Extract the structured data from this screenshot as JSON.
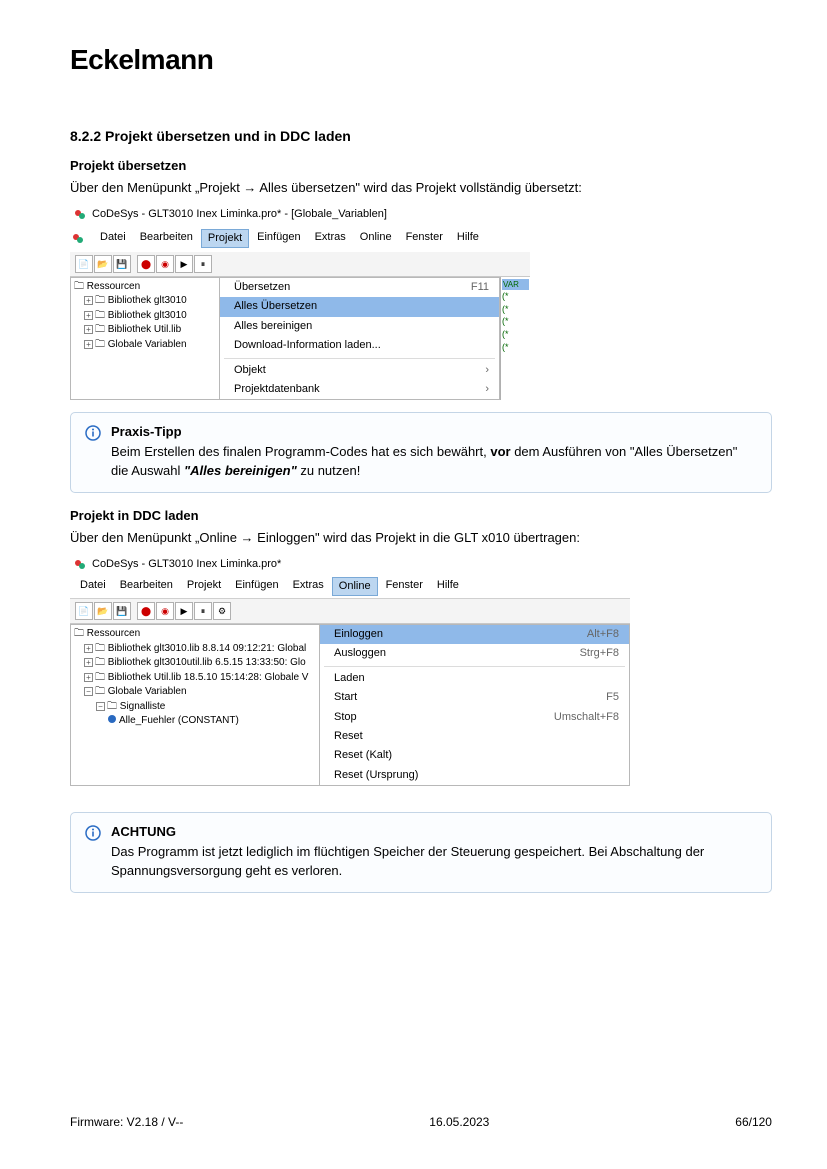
{
  "brand": "Eckelmann",
  "section_number": "8.2.2",
  "section_title": "Projekt übersetzen und in DDC laden",
  "part1": {
    "heading": "Projekt übersetzen",
    "intro": "Über den Menüpunkt „Projekt → Alles übersetzen\" wird das Projekt vollständig übersetzt:",
    "window_title": "CoDeSys - GLT3010 Inex Liminka.pro* - [Globale_Variablen]",
    "menubar": [
      "Datei",
      "Bearbeiten",
      "Projekt",
      "Einfügen",
      "Extras",
      "Online",
      "Fenster",
      "Hilfe"
    ],
    "menu_selected_index": 2,
    "tree_root": "Ressourcen",
    "tree_items": [
      "Bibliothek glt3010",
      "Bibliothek glt3010",
      "Bibliothek Util.lib",
      "Globale Variablen"
    ],
    "dropdown_items": [
      {
        "label": "Übersetzen",
        "shortcut": "F11"
      },
      {
        "label": "Alles Übersetzen",
        "shortcut": "",
        "hi": true
      },
      {
        "label": "Alles bereinigen",
        "shortcut": ""
      },
      {
        "label": "Download-Information laden...",
        "shortcut": ""
      },
      {
        "sep": true
      },
      {
        "label": "Objekt",
        "shortcut": "›"
      },
      {
        "label": "Projektdatenbank",
        "shortcut": "›"
      }
    ],
    "side_header": "VAR",
    "side_rows": [
      "(*",
      "(*",
      "(*",
      "(*",
      "(*"
    ]
  },
  "tip": {
    "title": "Praxis-Tipp",
    "text_pre": "Beim Erstellen des finalen Programm-Codes hat es sich bewährt, ",
    "bold1": "vor",
    "text_mid": " dem Ausführen von \"Alles Übersetzen\" die Auswahl ",
    "bolditalic": "\"Alles bereinigen\"",
    "text_post": " zu nutzen!"
  },
  "part2": {
    "heading": "Projekt in DDC laden",
    "intro": "Über den Menüpunkt „Online → Einloggen\" wird das Projekt in die GLT x010 übertragen:",
    "window_title": "CoDeSys - GLT3010 Inex Liminka.pro*",
    "menubar": [
      "Datei",
      "Bearbeiten",
      "Projekt",
      "Einfügen",
      "Extras",
      "Online",
      "Fenster",
      "Hilfe"
    ],
    "menu_selected_index": 5,
    "tree_root": "Ressourcen",
    "tree_items": [
      "Bibliothek glt3010.lib 8.8.14 09:12:21: Global",
      "Bibliothek glt3010util.lib 6.5.15 13:33:50: Glo",
      "Bibliothek Util.lib 18.5.10 15:14:28: Globale V",
      "Globale Variablen"
    ],
    "tree_sub": [
      "Signalliste",
      "Alle_Fuehler (CONSTANT)"
    ],
    "dropdown_items": [
      {
        "label": "Einloggen",
        "shortcut": "Alt+F8",
        "hi": true
      },
      {
        "label": "Ausloggen",
        "shortcut": "Strg+F8"
      },
      {
        "sep": true
      },
      {
        "label": "Laden",
        "shortcut": ""
      },
      {
        "label": "Start",
        "shortcut": "F5"
      },
      {
        "label": "Stop",
        "shortcut": "Umschalt+F8"
      },
      {
        "label": "Reset",
        "shortcut": ""
      },
      {
        "label": "Reset (Kalt)",
        "shortcut": ""
      },
      {
        "label": "Reset (Ursprung)",
        "shortcut": ""
      }
    ]
  },
  "warn": {
    "title": "ACHTUNG",
    "text": "Das Programm ist jetzt lediglich im flüchtigen Speicher der Steuerung gespeichert. Bei Abschaltung der Spannungsversorgung geht es verloren."
  },
  "footer": {
    "left": "Firmware: V2.18 / V--",
    "center": "16.05.2023",
    "right": "66/120"
  }
}
